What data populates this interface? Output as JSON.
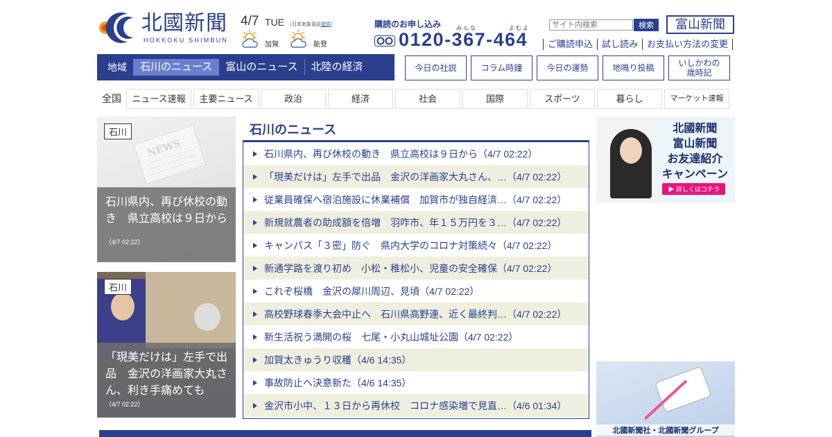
{
  "logo": {
    "title": "北國新聞",
    "subtitle": "HOKKOKU SHIMBUN"
  },
  "date": {
    "date": "4/7",
    "day": "TUE",
    "jma_prefix": "（日本気象協会",
    "jma_link": "提供",
    "jma_suffix": "）"
  },
  "weather": [
    {
      "label": "加賀"
    },
    {
      "label": "能登"
    }
  ],
  "subscribe": {
    "title": "購読のお申し込み",
    "ruby1": "みんな",
    "ruby2": "よむよ",
    "phone": "0120-367-464"
  },
  "search": {
    "placeholder": "サイト内検索",
    "button": "検索"
  },
  "toyama_logo": "富山新聞",
  "util_links": [
    "ご購読申込",
    "試し読み",
    "お支払い方法の変更"
  ],
  "region_nav": {
    "label": "地域",
    "tabs": [
      "石川のニュース",
      "富山のニュース",
      "北陸の経済"
    ]
  },
  "box_links": [
    "今日の社説",
    "コラム時鐘",
    "今日の運勢",
    "地鳴り投稿",
    "いしかわの\n歳時記"
  ],
  "category_bar": {
    "label": "全国",
    "items": [
      "ニュース速報",
      "主要ニュース",
      "政治",
      "経済",
      "社会",
      "国際",
      "スポーツ",
      "暮らし",
      "マーケット速報"
    ]
  },
  "cards": [
    {
      "tag": "石川",
      "title": "石川県内、再び休校の動き　県立高校は９日から",
      "time": "（4/7 02:22）"
    },
    {
      "tag": "石川",
      "title": "「現美だけは」左手で出品　金沢の洋画家大丸さん、利き手痛めても",
      "time": "（4/7 02:22）"
    }
  ],
  "news": {
    "heading": "石川のニュース",
    "items": [
      "石川県内、再び休校の動き　県立高校は９日から（4/7 02:22）",
      "「現美だけは」左手で出品　金沢の洋画家大丸さん、…（4/7 02:22）",
      "従業員確保へ宿泊施設に休業補償　加賀市が独自経済…（4/7 02:22）",
      "新規就農者の助成額を倍増　羽咋市、年１５万円を３…（4/7 02:22）",
      "キャンパス「３密」防ぐ　県内大学のコロナ対策続々（4/7 02:22）",
      "新通学路を渡り初め　小松・稚松小、児童の安全確保（4/7 02:22）",
      "これぞ桜橋　金沢の犀川周辺、見頃（4/7 02:22）",
      "高校野球春季大会中止へ　石川県高野連、近く最終判…（4/7 02:22）",
      "新生活祝う満開の桜　七尾・小丸山城址公園（4/7 02:22）",
      "加賀太きゅうり収穫（4/6 14:35）",
      "事故防止へ決意新た（4/6 14:35）",
      "金沢市小中、１３日から再休校　コロナ感染増で見直…（4/6 01:34）"
    ]
  },
  "ads": {
    "ad1": {
      "line1": "北國新聞",
      "line2": "富山新聞",
      "line3": "お友達紹介",
      "line4": "キャンペーン",
      "button": "▶ 詳しくはコチラ"
    },
    "ad2": {
      "text": "北國新聞社・北國新聞グループ"
    }
  },
  "colors": {
    "brand": "#2a3f8e",
    "active_tab": "#6b7fcf",
    "stripe": "#efefdf",
    "ad_pink": "#e7157d"
  }
}
